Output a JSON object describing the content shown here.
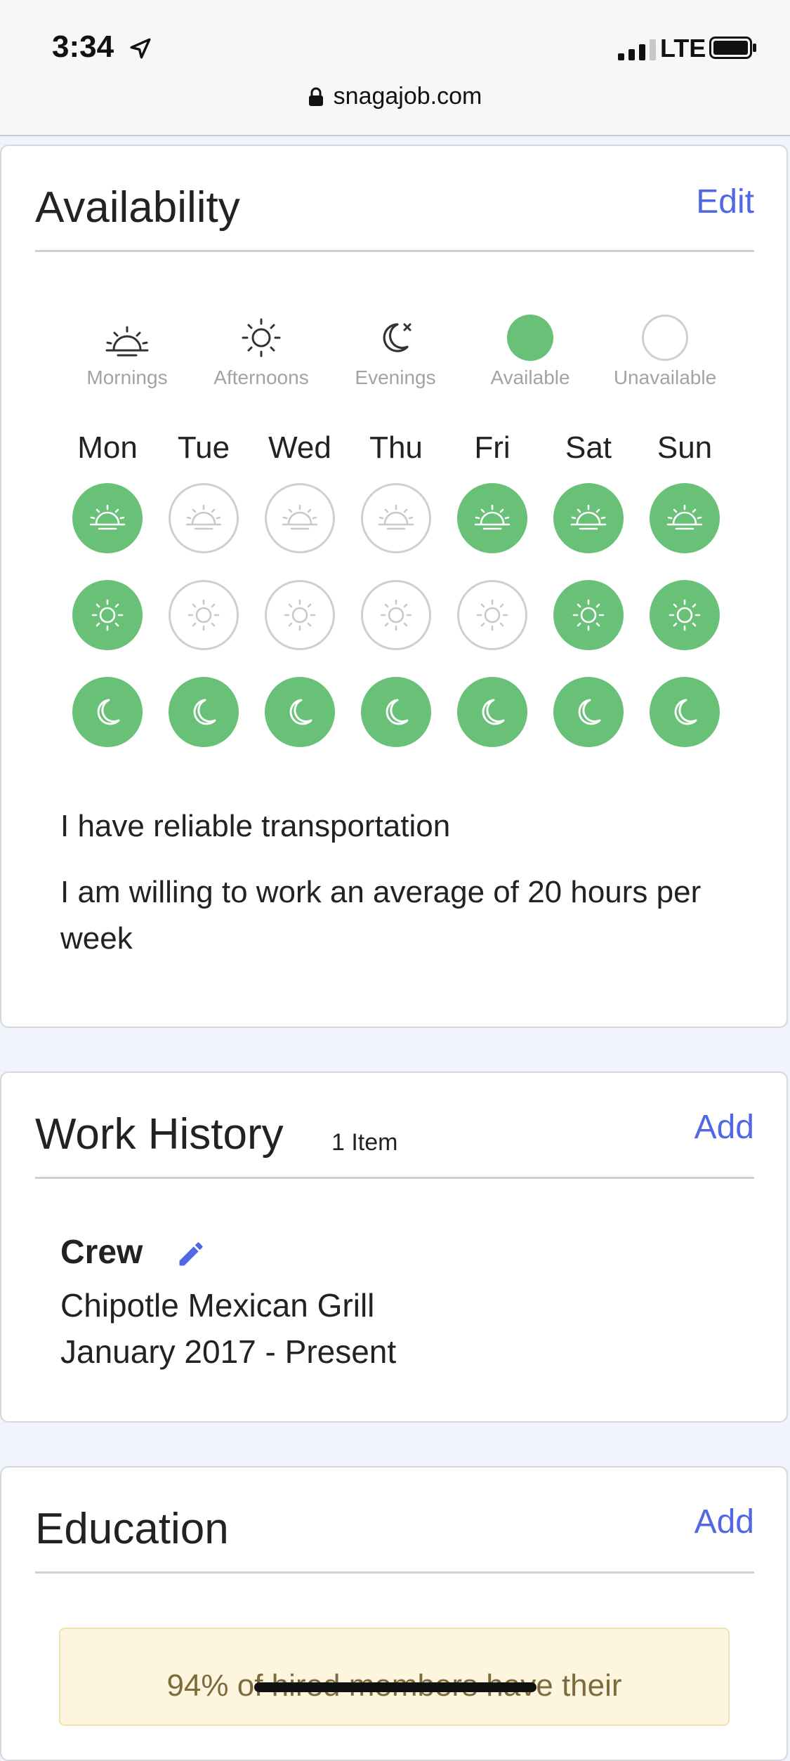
{
  "status_bar": {
    "time": "3:34",
    "network": "LTE",
    "url": "snagajob.com"
  },
  "availability": {
    "title": "Availability",
    "edit_label": "Edit",
    "legend": [
      {
        "icon": "sunrise-icon",
        "label": "Mornings"
      },
      {
        "icon": "sun-icon",
        "label": "Afternoons"
      },
      {
        "icon": "moon-icon",
        "label": "Evenings"
      },
      {
        "icon": "available-dot-icon",
        "label": "Available"
      },
      {
        "icon": "unavailable-dot-icon",
        "label": "Unavailable"
      }
    ],
    "days": [
      "Mon",
      "Tue",
      "Wed",
      "Thu",
      "Fri",
      "Sat",
      "Sun"
    ],
    "grid": {
      "mornings": [
        true,
        false,
        false,
        false,
        true,
        true,
        true
      ],
      "afternoons": [
        true,
        false,
        false,
        false,
        false,
        true,
        true
      ],
      "evenings": [
        true,
        true,
        true,
        true,
        true,
        true,
        true
      ]
    },
    "transportation": "I have reliable transportation",
    "hours": "I am willing to work an average of 20 hours per week",
    "colors": {
      "available": "#68c177",
      "unavailable_border": "#cfcfcf",
      "link": "#5167e6"
    }
  },
  "work_history": {
    "title": "Work History",
    "count": "1 Item",
    "add_label": "Add",
    "jobs": [
      {
        "title": "Crew",
        "employer": "Chipotle Mexican Grill",
        "dates": "January 2017 - Present"
      }
    ]
  },
  "education": {
    "title": "Education",
    "add_label": "Add",
    "promo": "94% of hired members have their"
  }
}
